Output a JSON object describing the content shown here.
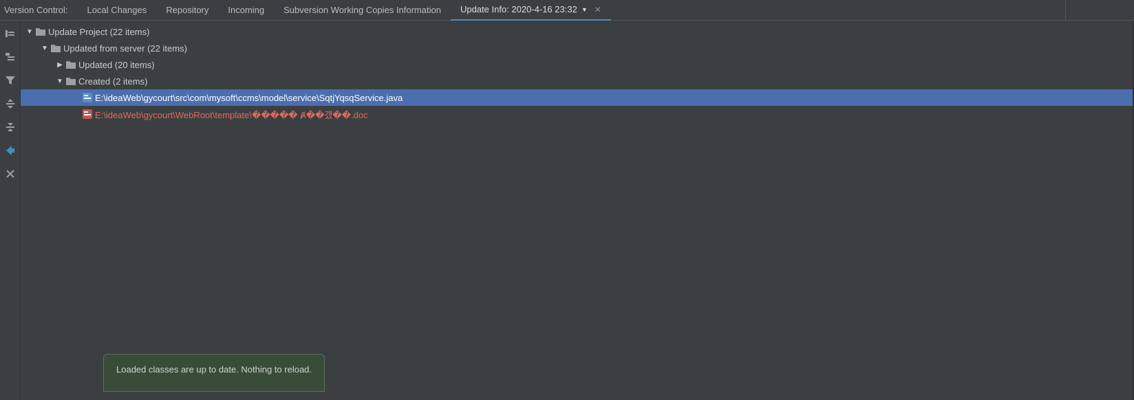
{
  "tabstrip": {
    "vc_label": "Version Control:",
    "tabs": [
      {
        "label": "Local Changes",
        "active": false
      },
      {
        "label": "Repository",
        "active": false
      },
      {
        "label": "Incoming",
        "active": false
      },
      {
        "label": "Subversion Working Copies Information",
        "active": false
      },
      {
        "label": "Update Info: 2020-4-16 23:32",
        "active": true,
        "has_dropdown": true,
        "closable": true
      }
    ]
  },
  "tree": {
    "root": {
      "arrow": "expanded",
      "label": "Update Project (22 items)"
    },
    "updated_from_server": {
      "arrow": "expanded",
      "label": "Updated from server (22 items)"
    },
    "updated": {
      "arrow": "collapsed",
      "label": "Updated (20 items)"
    },
    "created": {
      "arrow": "expanded",
      "label": "Created (2 items)"
    },
    "file_selected": {
      "path": "E:\\ideaWeb\\gycourt\\src\\com\\mysoft\\ccms\\model\\service\\SqtjYqsqService.java"
    },
    "file_red": {
      "path": "E:\\ideaWeb\\gycourt\\WebRoot\\template\\����� Ⱥ��걨��.doc"
    }
  },
  "notification": {
    "text": "Loaded classes are up to date. Nothing to reload."
  }
}
